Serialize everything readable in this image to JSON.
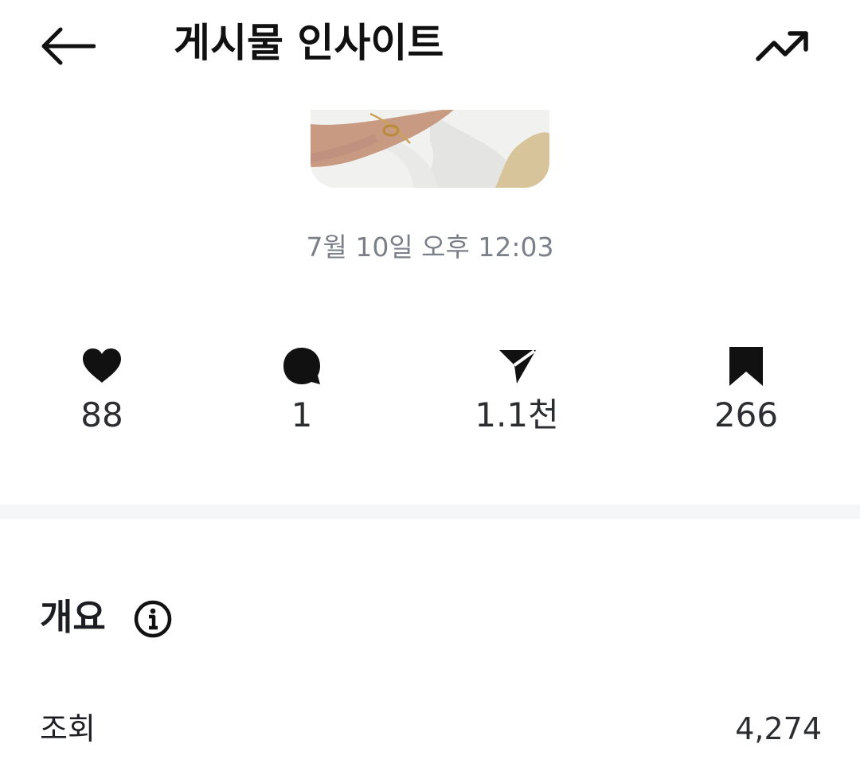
{
  "header": {
    "title": "게시물 인사이트",
    "back_icon": "arrow-left-icon",
    "trend_icon": "trending-up-icon"
  },
  "post": {
    "date": "7월 10일 오후 12:03"
  },
  "stats": [
    {
      "icon": "heart-icon",
      "value": "88"
    },
    {
      "icon": "comment-icon",
      "value": "1"
    },
    {
      "icon": "send-icon",
      "value": "1.1천"
    },
    {
      "icon": "bookmark-icon",
      "value": "266"
    }
  ],
  "overview": {
    "title": "개요",
    "info_icon": "info-icon",
    "rows": [
      {
        "label": "조회",
        "value": "4,274"
      }
    ]
  },
  "colors": {
    "text": "#1c1e21",
    "muted": "#7b8088",
    "divider": "#f5f6f7"
  }
}
